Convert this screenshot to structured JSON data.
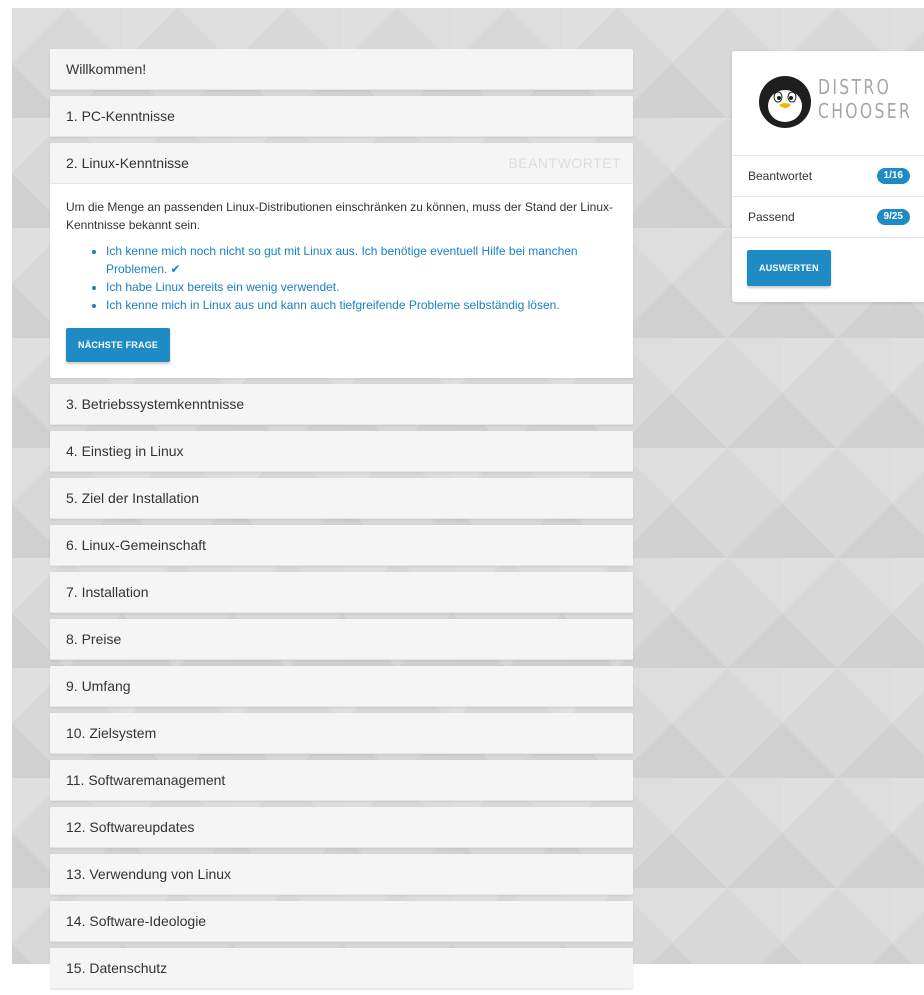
{
  "questions": [
    {
      "label": "Willkommen!"
    },
    {
      "label": "1. PC-Kenntnisse"
    },
    {
      "label": "2. Linux-Kenntnisse",
      "status": "BEANTWORTET"
    },
    {
      "label": "3. Betriebssystemkenntnisse"
    },
    {
      "label": "4. Einstieg in Linux"
    },
    {
      "label": "5. Ziel der Installation"
    },
    {
      "label": "6. Linux-Gemeinschaft"
    },
    {
      "label": "7. Installation"
    },
    {
      "label": "8. Preise"
    },
    {
      "label": "9. Umfang"
    },
    {
      "label": "10. Zielsystem"
    },
    {
      "label": "11. Softwaremanagement"
    },
    {
      "label": "12. Softwareupdates"
    },
    {
      "label": "13. Verwendung von Linux"
    },
    {
      "label": "14. Software-Ideologie"
    },
    {
      "label": "15. Datenschutz"
    }
  ],
  "current": {
    "text": "Um die Menge an passenden Linux-Distributionen einschränken zu können, muss der Stand der Linux-Kenntnisse bekannt sein.",
    "answers": [
      {
        "text": "Ich kenne mich noch nicht so gut mit Linux aus. Ich benötige eventuell Hilfe bei manchen Problemen.",
        "selected": true
      },
      {
        "text": "Ich habe Linux bereits ein wenig verwendet."
      },
      {
        "text": "Ich kenne mich in Linux aus und kann auch tiefgreifende Probleme selbständig lösen."
      }
    ],
    "next_button": "NÄCHSTE FRAGE",
    "selected_mark": "✔"
  },
  "sidebar": {
    "logo_line1": "DISTRO",
    "logo_line2": "CHOOSER",
    "answered_label": "Beantwortet",
    "answered_value": "1/16",
    "matching_label": "Passend",
    "matching_value": "9/25",
    "evaluate_button": "AUSWERTEN"
  },
  "colors": {
    "accent": "#1f8bc5",
    "link": "#1a7fc1",
    "background": "#d8d8d8"
  }
}
